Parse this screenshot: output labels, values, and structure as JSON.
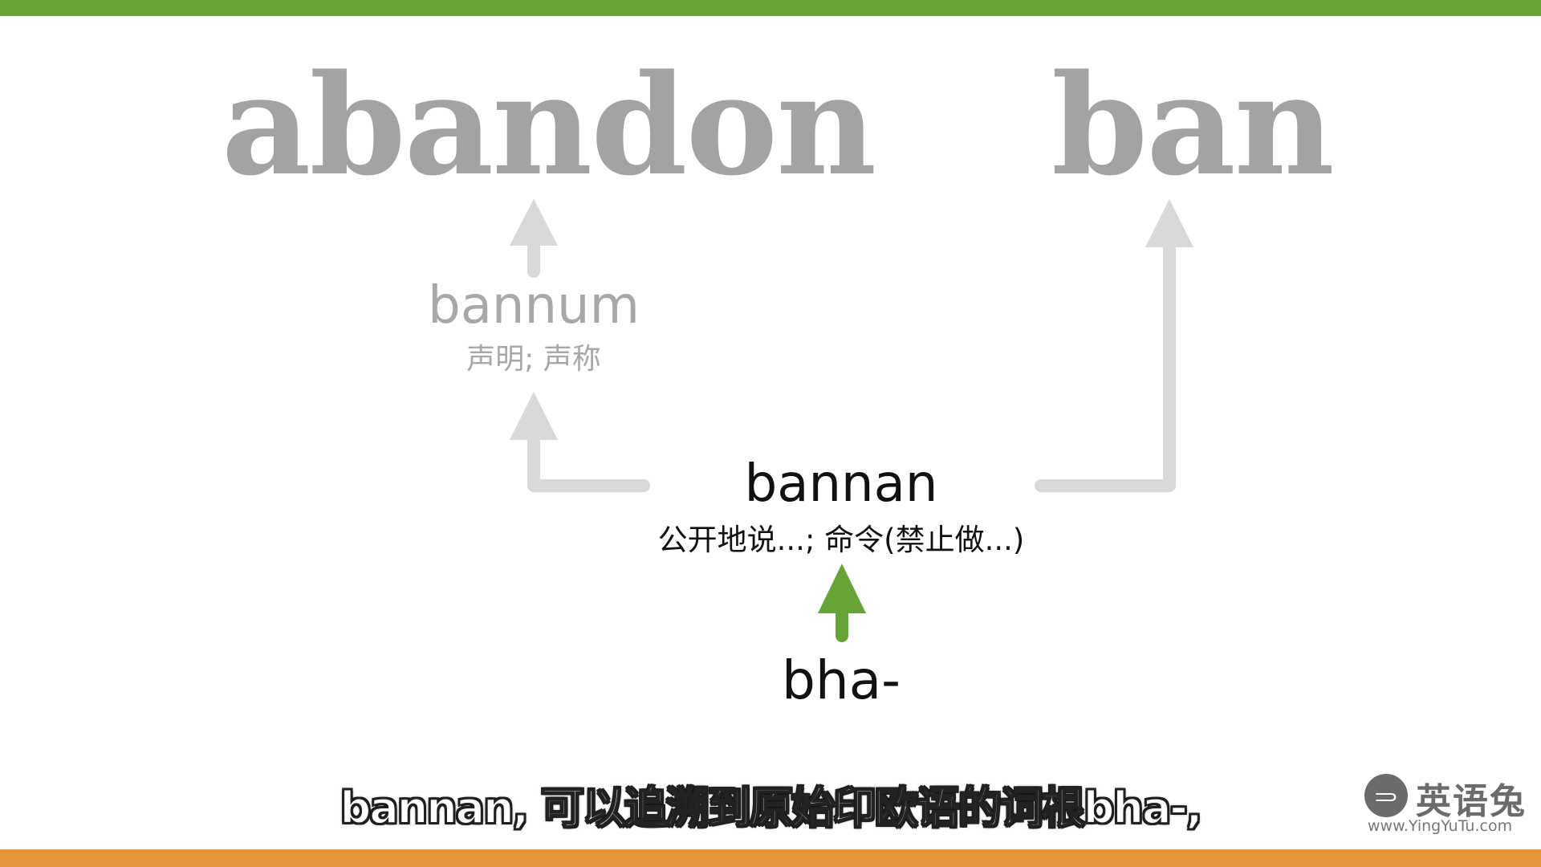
{
  "colors": {
    "top_bar": "#67a337",
    "bottom_bar": "#e6963a",
    "faded_text": "#a3a3a3",
    "faded_arrow": "#d9d9d9",
    "active_arrow": "#67a337",
    "active_text": "#111111"
  },
  "targets": {
    "abandon": "abandon",
    "ban": "ban"
  },
  "nodes": {
    "bannum": {
      "word": "bannum",
      "gloss": "声明; 声称"
    },
    "bannan": {
      "word": "bannan",
      "gloss": "公开地说...; 命令(禁止做...)"
    },
    "bha": {
      "word": "bha-"
    }
  },
  "subtitle": "bannan, 可以追溯到原始印欧语的词根bha-,",
  "logo": {
    "icon": "rabbit-icon",
    "name": "英语兔",
    "url": "www.YingYuTu.com"
  }
}
